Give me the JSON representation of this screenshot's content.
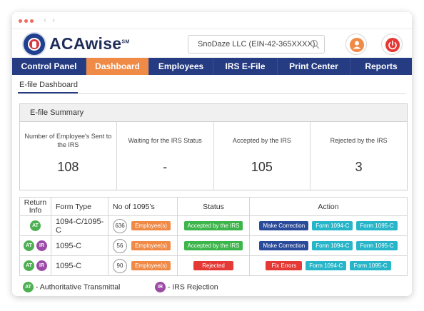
{
  "header": {
    "brand": "ACAwise",
    "brand_mark": "SM",
    "company": "SnoDaze LLC (EIN-42-365XXXX)"
  },
  "nav": {
    "items": [
      {
        "label": "Control Panel"
      },
      {
        "label": "Dashboard"
      },
      {
        "label": "Employees"
      },
      {
        "label": "IRS E-File"
      },
      {
        "label": "Print Center"
      },
      {
        "label": "Reports"
      }
    ],
    "active": "Dashboard"
  },
  "subtab": {
    "label": "E-file Dashboard"
  },
  "summary": {
    "title": "E-file Summary",
    "cards": [
      {
        "label": "Number of Employee's Sent to the IRS",
        "value": "108"
      },
      {
        "label": "Waiting for the IRS Status",
        "value": "-"
      },
      {
        "label": "Accepted by the IRS",
        "value": "105"
      },
      {
        "label": "Rejected by the IRS",
        "value": "3"
      }
    ]
  },
  "table": {
    "headers": {
      "return_info": "Return Info",
      "form_type": "Form Type",
      "no_1095": "No of 1095’s",
      "status": "Status",
      "action": "Action"
    },
    "rows": [
      {
        "info": [
          "AT"
        ],
        "form_type": "1094-C/1095-C",
        "count": "636",
        "employees": "Employee(s)",
        "status": "Accepted by the IRS",
        "actions": [
          "Make Correction",
          "Form 1094-C",
          "Form 1095-C"
        ]
      },
      {
        "info": [
          "AT",
          "IR"
        ],
        "form_type": "1095-C",
        "count": "56",
        "employees": "Employee(s)",
        "status": "Accepted by the IRS",
        "actions": [
          "Make Correction",
          "Form 1094-C",
          "Form 1095-C"
        ]
      },
      {
        "info": [
          "AT",
          "IR"
        ],
        "form_type": "1095-C",
        "count": "90",
        "employees": "Employee(s)",
        "status": "Rejected",
        "actions": [
          "Fix Errors",
          "Form 1094-C",
          "Form 1095-C"
        ]
      }
    ]
  },
  "legend": {
    "at_badge": "AT",
    "at_text": "- Authoritative Transmittal",
    "ir_badge": "IR",
    "ir_text": "- IRS Rejection"
  },
  "colors": {
    "nav_bg": "#253b82",
    "nav_active": "#f08a47",
    "accepted": "#3cb54a",
    "rejected": "#e53935",
    "correction": "#2a4a9a",
    "form_btn": "#27b6c9"
  }
}
